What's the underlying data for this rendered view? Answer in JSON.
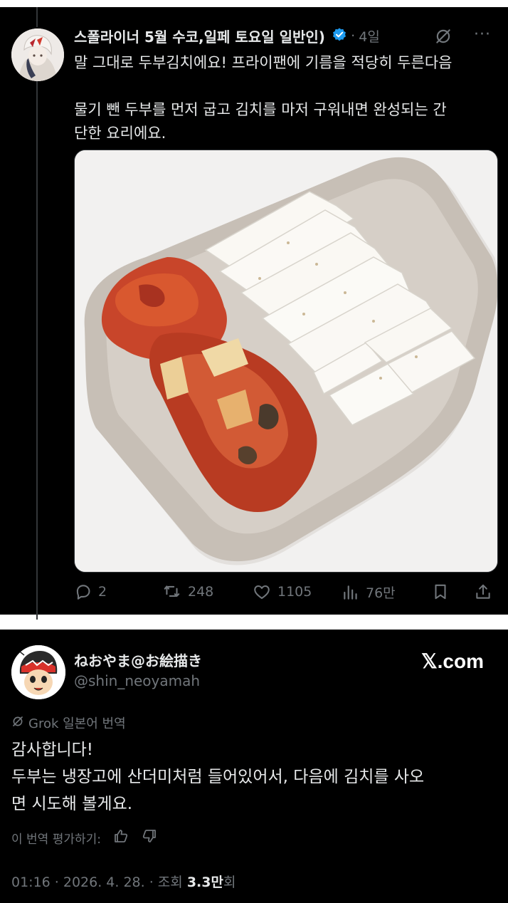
{
  "tweet": {
    "author_name": "스폴라이너 5월 수코,일페 토요일 일반인)",
    "separator": "·",
    "time": "4일",
    "more_label": "···",
    "body_line1": "말 그대로 두부김치에요! 프라이팬에 기름을 적당히 두른다음",
    "body_line2": "물기 뺀 두부를 먼저 굽고 김치를 마저 구워내면 완성되는 간",
    "body_line3": "단한 요리에요.",
    "stats": {
      "replies": "2",
      "reposts": "248",
      "likes": "1105",
      "views": "76만"
    },
    "icons": [
      "verified-icon",
      "grok-icon",
      "more-icon",
      "reply-icon",
      "repost-icon",
      "like-icon",
      "views-icon",
      "bookmark-icon",
      "share-icon"
    ],
    "accent_color": "#1d9bf0"
  },
  "reply": {
    "author_name": "ねおやま@お絵描き",
    "handle": "@shin_neoyamah",
    "source_logo": "𝕏.com",
    "translated_label": "Grok 일본어 번역",
    "body_line1": "감사합니다!",
    "body_line2": "두부는 냉장고에 산더미처럼 들어있어서, 다음에 김치를 사오",
    "body_line3": "면 시도해 볼게요.",
    "rate_label": "이 번역 평가하기:",
    "meta_time": "01:16 · 2026. 4. 28. · 조회 ",
    "meta_views": "3.3만",
    "meta_suffix": "회"
  }
}
